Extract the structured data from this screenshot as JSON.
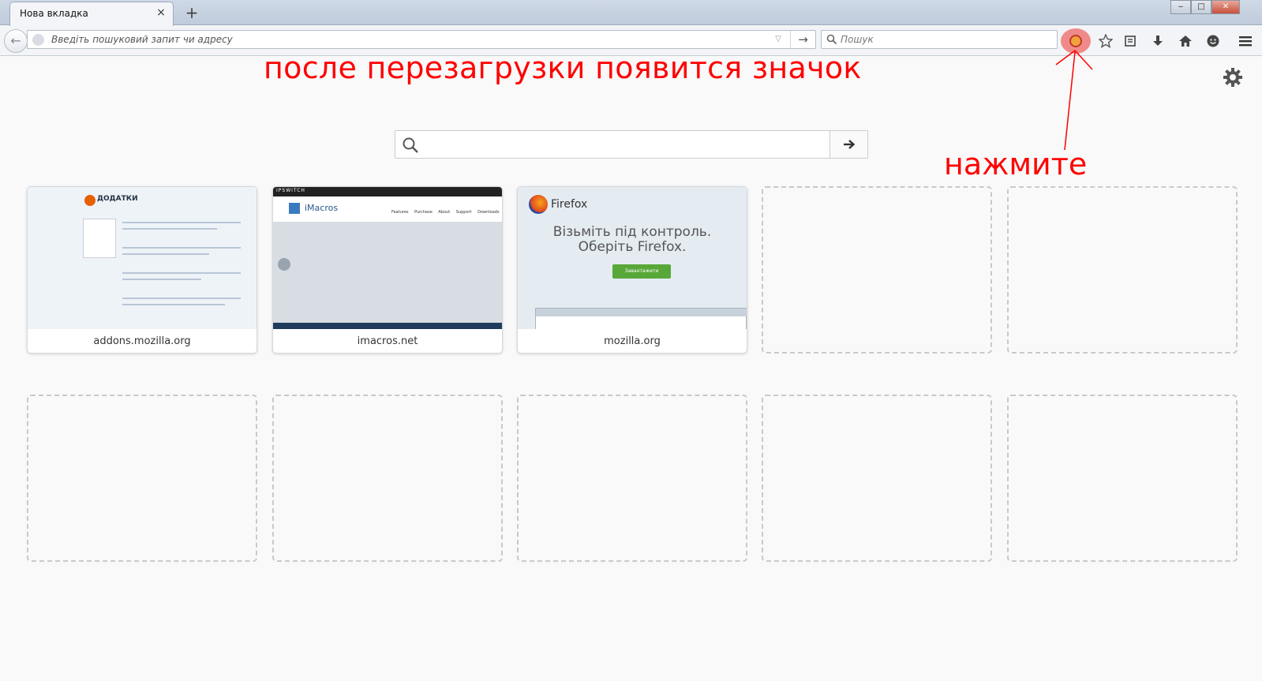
{
  "window": {
    "tab_title": "Нова вкладка",
    "tab_close": "×",
    "new_tab": "+",
    "minimize": "‒",
    "maximize": "□",
    "close": "✕"
  },
  "navbar": {
    "back": "←",
    "url_placeholder": "Введіть пошуковий запит чи адресу",
    "url_dropdown": "▽",
    "url_go": "→",
    "search_placeholder": "Пошук"
  },
  "annotations": {
    "top": "после перезагрузки появится значок",
    "click": "нажмите",
    "color": "#ff0000"
  },
  "content": {
    "search_go": "→"
  },
  "tiles": [
    {
      "label": "addons.mozilla.org"
    },
    {
      "label": "imacros.net"
    },
    {
      "label": "mozilla.org"
    }
  ],
  "thumbs": {
    "addons_title": "ДОДАТКИ",
    "imacros_brand": "IPSWITCH",
    "imacros_logo": "iMacros",
    "imacros_menu": "Features Purchase About Support Downloads",
    "moz_brand": "Firefox",
    "moz_headline_1": "Візьміть під контроль.",
    "moz_headline_2": "Оберіть Firefox.",
    "moz_button": "Завантажити"
  }
}
